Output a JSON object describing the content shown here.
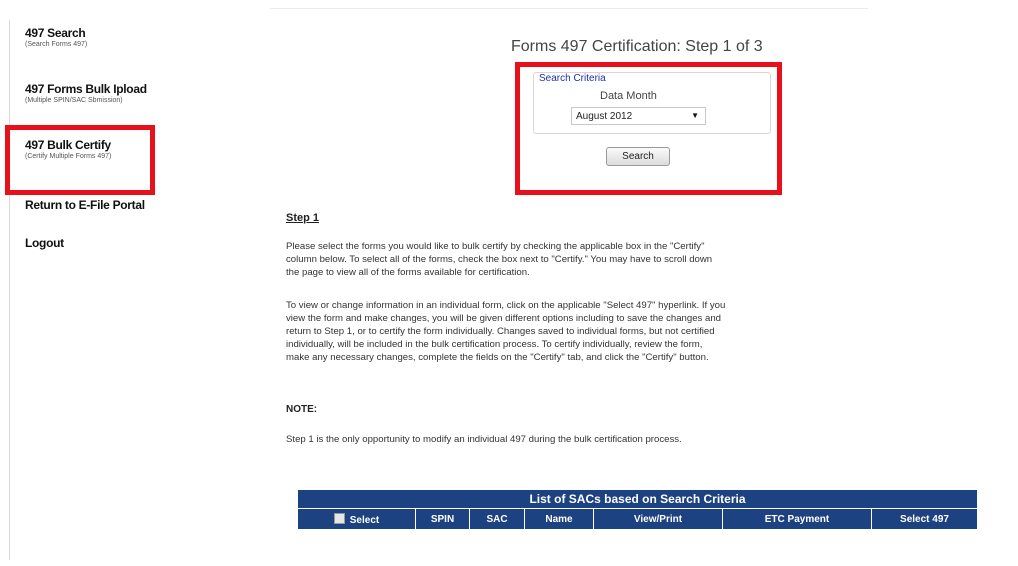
{
  "sidebar": {
    "items": [
      {
        "title": "497 Search",
        "subtitle": "(Search Forms 497)"
      },
      {
        "title": "497 Forms Bulk Ipload",
        "subtitle": "(Multiple SPIN/SAC Sbmission)"
      },
      {
        "title": "497 Bulk Certify",
        "subtitle": "(Certify Multiple Forms 497)"
      },
      {
        "title": "Return to E-File Portal",
        "subtitle": ""
      },
      {
        "title": "Logout",
        "subtitle": ""
      }
    ]
  },
  "page": {
    "title": "Forms 497 Certification: Step 1 of 3"
  },
  "search_criteria": {
    "legend": "Search Criteria",
    "data_month_label": "Data Month",
    "selected_month": "August 2012",
    "search_button": "Search"
  },
  "content": {
    "step_heading": "Step 1",
    "para1": "Please select the forms you would like to bulk certify by checking the applicable box in the \"Certify\" column below. To select all of the forms, check the box next to \"Certify.\" You may have to scroll down the page to view all of the forms available for certification.",
    "para2": "To view or change information in an individual form, click on the applicable \"Select 497\" hyperlink. If you view the form and make changes, you will be given different options including to save the changes and return to Step 1, or to certify the form individually. Changes saved to individual forms, but not certified individually, will be included in the bulk certification process. To certify individually, review the form, make any necessary changes, complete the fields on the \"Certify\" tab, and click the \"Certify\" button.",
    "note_heading": "NOTE:",
    "note_text": "Step 1 is the only opportunity to modify an individual 497 during the bulk certification process."
  },
  "table": {
    "caption": "List of SACs based on Search Criteria",
    "columns": [
      "Select",
      "SPIN",
      "SAC",
      "Name",
      "View/Print",
      "ETC Payment",
      "Select 497"
    ]
  },
  "colors": {
    "highlight": "#e8101a",
    "table_header": "#1d4281",
    "link": "#1a2fb0"
  }
}
